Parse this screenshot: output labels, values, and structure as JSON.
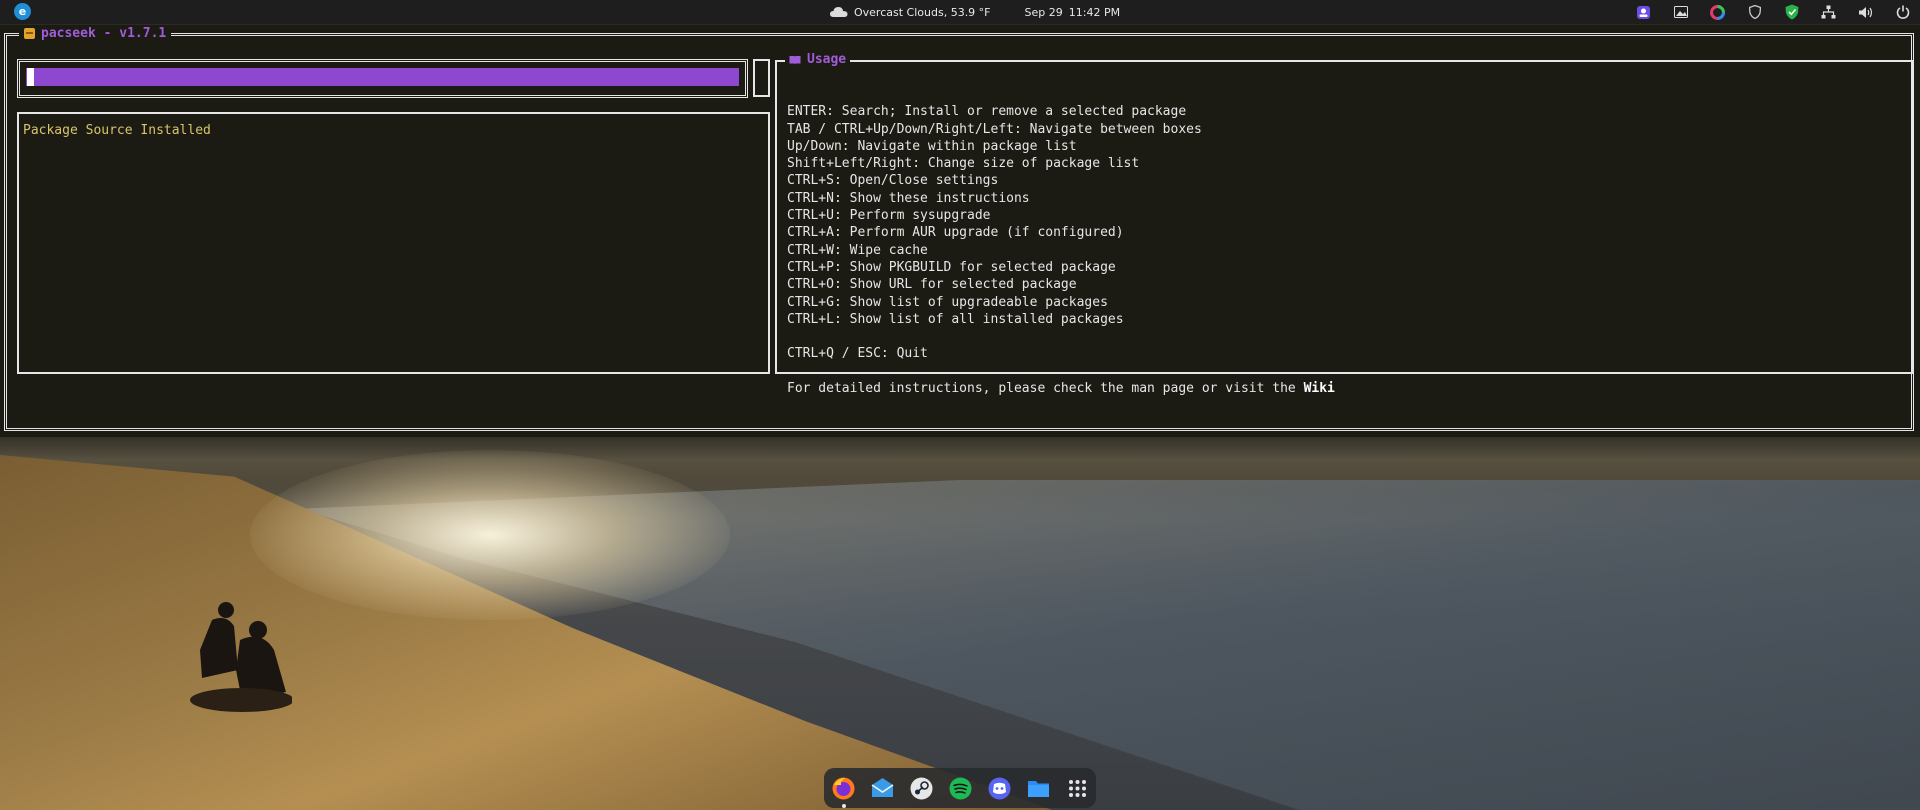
{
  "topbar": {
    "weather": "Overcast Clouds, 53.9 °F",
    "date": "Sep 29",
    "time": "11:42 PM",
    "tray_icons": [
      "apps-icon",
      "screenshot-icon",
      "color-wheel-icon",
      "shield-icon",
      "shield-check-icon",
      "network-icon",
      "volume-icon",
      "power-icon"
    ]
  },
  "terminal": {
    "title": "pacseek - v1.7.1",
    "search": {
      "value": "",
      "placeholder": ""
    },
    "package_list": {
      "columns": [
        "Package",
        "Source",
        "Installed"
      ]
    },
    "usage": {
      "title": "Usage",
      "lines": [
        "",
        "ENTER: Search; Install or remove a selected package",
        "TAB / CTRL+Up/Down/Right/Left: Navigate between boxes",
        "Up/Down: Navigate within package list",
        "Shift+Left/Right: Change size of package list",
        "CTRL+S: Open/Close settings",
        "CTRL+N: Show these instructions",
        "CTRL+U: Perform sysupgrade",
        "CTRL+A: Perform AUR upgrade (if configured)",
        "CTRL+W: Wipe cache",
        "CTRL+P: Show PKGBUILD for selected package",
        "CTRL+O: Show URL for selected package",
        "CTRL+G: Show list of upgradeable packages",
        "CTRL+L: Show list of all installed packages",
        "",
        "CTRL+Q / ESC: Quit",
        ""
      ],
      "footer_text": "For detailed instructions, please check the man page or visit the ",
      "footer_link": "Wiki"
    },
    "colors": {
      "accent_purple": "#a15cd9",
      "search_bar": "#8e47cf",
      "header_yellow": "#d8c46a",
      "background": "#1b1b14",
      "border": "#e6e6e6"
    }
  },
  "dock": {
    "items": [
      {
        "name": "firefox-icon",
        "running": true
      },
      {
        "name": "mail-icon",
        "running": false
      },
      {
        "name": "steam-icon",
        "running": false
      },
      {
        "name": "spotify-icon",
        "running": false
      },
      {
        "name": "discord-icon",
        "running": false
      },
      {
        "name": "files-icon",
        "running": false
      },
      {
        "name": "app-grid-icon",
        "running": false
      }
    ]
  }
}
